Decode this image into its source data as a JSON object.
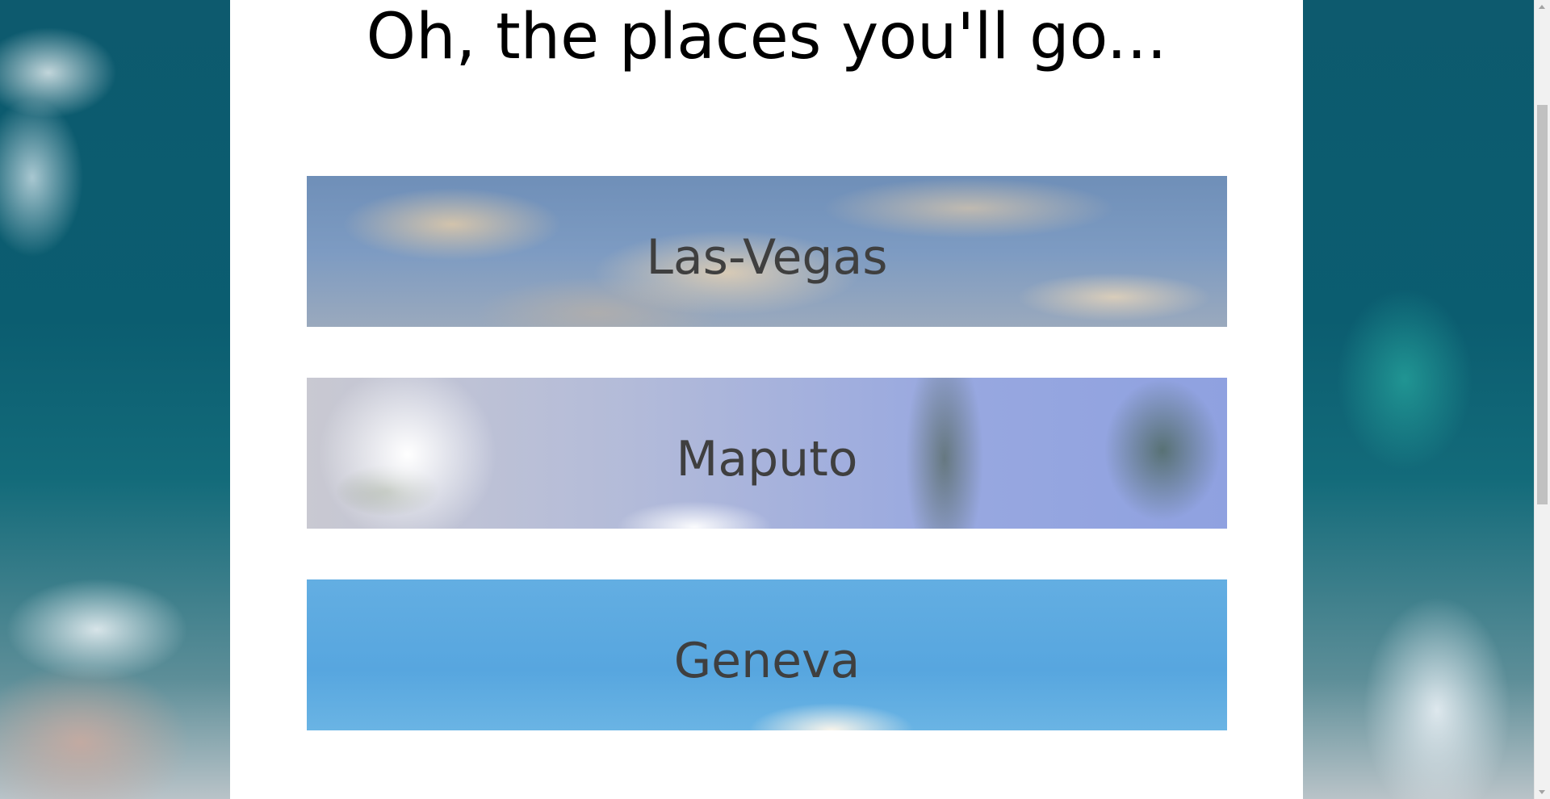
{
  "page": {
    "title": "Oh, the places you'll go..."
  },
  "places": [
    {
      "name": "Las-Vegas",
      "image": "cloudy-sky-photo"
    },
    {
      "name": "Maputo",
      "image": "palm-trees-sun-photo"
    },
    {
      "name": "Geneva",
      "image": "blue-sky-cloud-photo"
    }
  ],
  "background": {
    "image": "ocean-waves-aerial-photo",
    "content_color": "#ffffff",
    "label_color": "#3f3f3f"
  }
}
